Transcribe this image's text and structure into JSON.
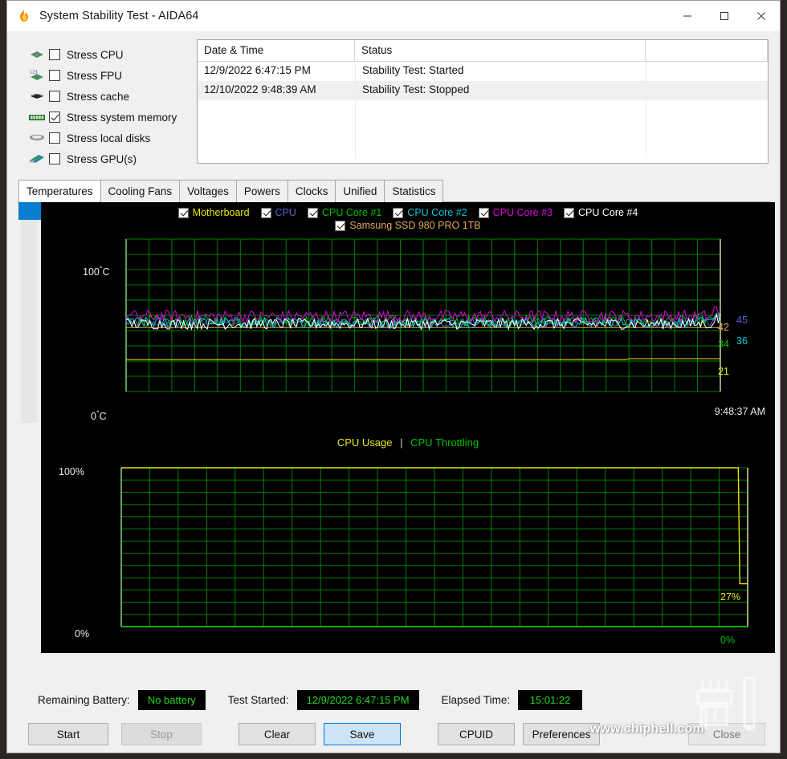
{
  "window": {
    "title": "System Stability Test - AIDA64",
    "app_icon": "flame-icon",
    "minimize_label": "–",
    "maximize_label": "❑",
    "close_label": "✕"
  },
  "stress_options": [
    {
      "label": "Stress CPU",
      "checked": false,
      "icon": "cpu-chip-icon"
    },
    {
      "label": "Stress FPU",
      "checked": false,
      "icon": "fpu-chip-icon"
    },
    {
      "label": "Stress cache",
      "checked": false,
      "icon": "cache-chip-icon"
    },
    {
      "label": "Stress system memory",
      "checked": true,
      "icon": "memory-module-icon"
    },
    {
      "label": "Stress local disks",
      "checked": false,
      "icon": "hard-disk-icon"
    },
    {
      "label": "Stress GPU(s)",
      "checked": false,
      "icon": "gpu-card-icon"
    }
  ],
  "log": {
    "columns": [
      "Date & Time",
      "Status"
    ],
    "rows": [
      {
        "datetime": "12/9/2022 6:47:15 PM",
        "status": "Stability Test: Started"
      },
      {
        "datetime": "12/10/2022 9:48:39 AM",
        "status": "Stability Test: Stopped"
      },
      {
        "datetime": "",
        "status": ""
      },
      {
        "datetime": "",
        "status": ""
      },
      {
        "datetime": "",
        "status": ""
      }
    ]
  },
  "tabs": [
    {
      "label": "Temperatures",
      "active": true
    },
    {
      "label": "Cooling Fans",
      "active": false
    },
    {
      "label": "Voltages",
      "active": false
    },
    {
      "label": "Powers",
      "active": false
    },
    {
      "label": "Clocks",
      "active": false
    },
    {
      "label": "Unified",
      "active": false
    },
    {
      "label": "Statistics",
      "active": false
    }
  ],
  "temperature_legend_row1": [
    {
      "label": "Motherboard",
      "color": "#e8e800",
      "checked": true
    },
    {
      "label": "CPU",
      "color": "#5a64d8",
      "checked": true
    },
    {
      "label": "CPU Core #1",
      "color": "#00c000",
      "checked": true
    },
    {
      "label": "CPU Core #2",
      "color": "#00c8d8",
      "checked": true
    },
    {
      "label": "CPU Core #3",
      "color": "#e000e0",
      "checked": true
    },
    {
      "label": "CPU Core #4",
      "color": "#ffffff",
      "checked": true
    }
  ],
  "temperature_legend_row2": [
    {
      "label": "Samsung SSD 980 PRO 1TB",
      "color": "#e0a860",
      "checked": true
    }
  ],
  "usage_legend": {
    "usage_label": "CPU Usage",
    "usage_color": "#e8e800",
    "separator": "|",
    "throttling_label": "CPU Throttling",
    "throttling_color": "#00c000"
  },
  "chart_data": [
    {
      "type": "line",
      "title": "Temperatures",
      "ylabel": "°C",
      "ylim": [
        0,
        100
      ],
      "y_tick_top": "100",
      "y_tick_top_unit": "°C",
      "y_tick_bottom": "0",
      "y_tick_bottom_unit": "°C",
      "grid": true,
      "grid_color": "#008000",
      "background": "#000000",
      "x_end_label": "9:48:37 AM",
      "current_values": [
        {
          "label": "Samsung SSD 980 PRO 1TB",
          "value": 42,
          "unit": "",
          "color": "#e0a860"
        },
        {
          "label": "CPU",
          "value": 45,
          "unit": "",
          "color": "#5a64d8"
        },
        {
          "label": "CPU Core #1",
          "value": 34,
          "unit": "",
          "color": "#00c000"
        },
        {
          "label": "CPU Core #2",
          "value": 36,
          "unit": "",
          "color": "#00c8d8"
        },
        {
          "label": "Motherboard",
          "value": 21,
          "unit": "",
          "color": "#e8e800"
        }
      ],
      "series": [
        {
          "name": "Motherboard",
          "color": "#e8e800",
          "level": 21,
          "noise": 0.0
        },
        {
          "name": "Samsung SSD 980 PRO 1TB",
          "color": "#e0a860",
          "level": 42,
          "noise": 0.0
        },
        {
          "name": "CPU",
          "color": "#5a64d8",
          "level": 45,
          "noise": 3.0
        },
        {
          "name": "CPU Core #1",
          "color": "#00c000",
          "level": 46,
          "noise": 3.5
        },
        {
          "name": "CPU Core #2",
          "color": "#00c8d8",
          "level": 45,
          "noise": 3.5
        },
        {
          "name": "CPU Core #3",
          "color": "#e000e0",
          "level": 49,
          "noise": 4.0
        },
        {
          "name": "CPU Core #4",
          "color": "#ffffff",
          "level": 44,
          "noise": 3.5
        }
      ]
    },
    {
      "type": "line",
      "title": "CPU Usage | CPU Throttling",
      "ylabel": "%",
      "ylim": [
        0,
        100
      ],
      "y_tick_top": "100%",
      "y_tick_bottom": "0%",
      "grid": true,
      "grid_color": "#008000",
      "background": "#000000",
      "current_values": [
        {
          "label": "CPU Usage",
          "value": "27%",
          "color": "#e8e800"
        },
        {
          "label": "CPU Throttling",
          "value": "0%",
          "color": "#00c000"
        }
      ],
      "series": [
        {
          "name": "CPU Usage",
          "color": "#e8e800",
          "level": 100,
          "end_level": 27
        },
        {
          "name": "CPU Throttling",
          "color": "#00c000",
          "level": 0,
          "end_level": 0
        }
      ]
    }
  ],
  "status": {
    "battery_label": "Remaining Battery:",
    "battery_value": "No battery",
    "started_label": "Test Started:",
    "started_value": "12/9/2022 6:47:15 PM",
    "elapsed_label": "Elapsed Time:",
    "elapsed_value": "15:01:22"
  },
  "buttons": {
    "start": "Start",
    "stop": "Stop",
    "clear": "Clear",
    "save": "Save",
    "cpuid": "CPUID",
    "preferences": "Preferences",
    "close": "Close"
  },
  "watermark": "www.chiphell.com"
}
